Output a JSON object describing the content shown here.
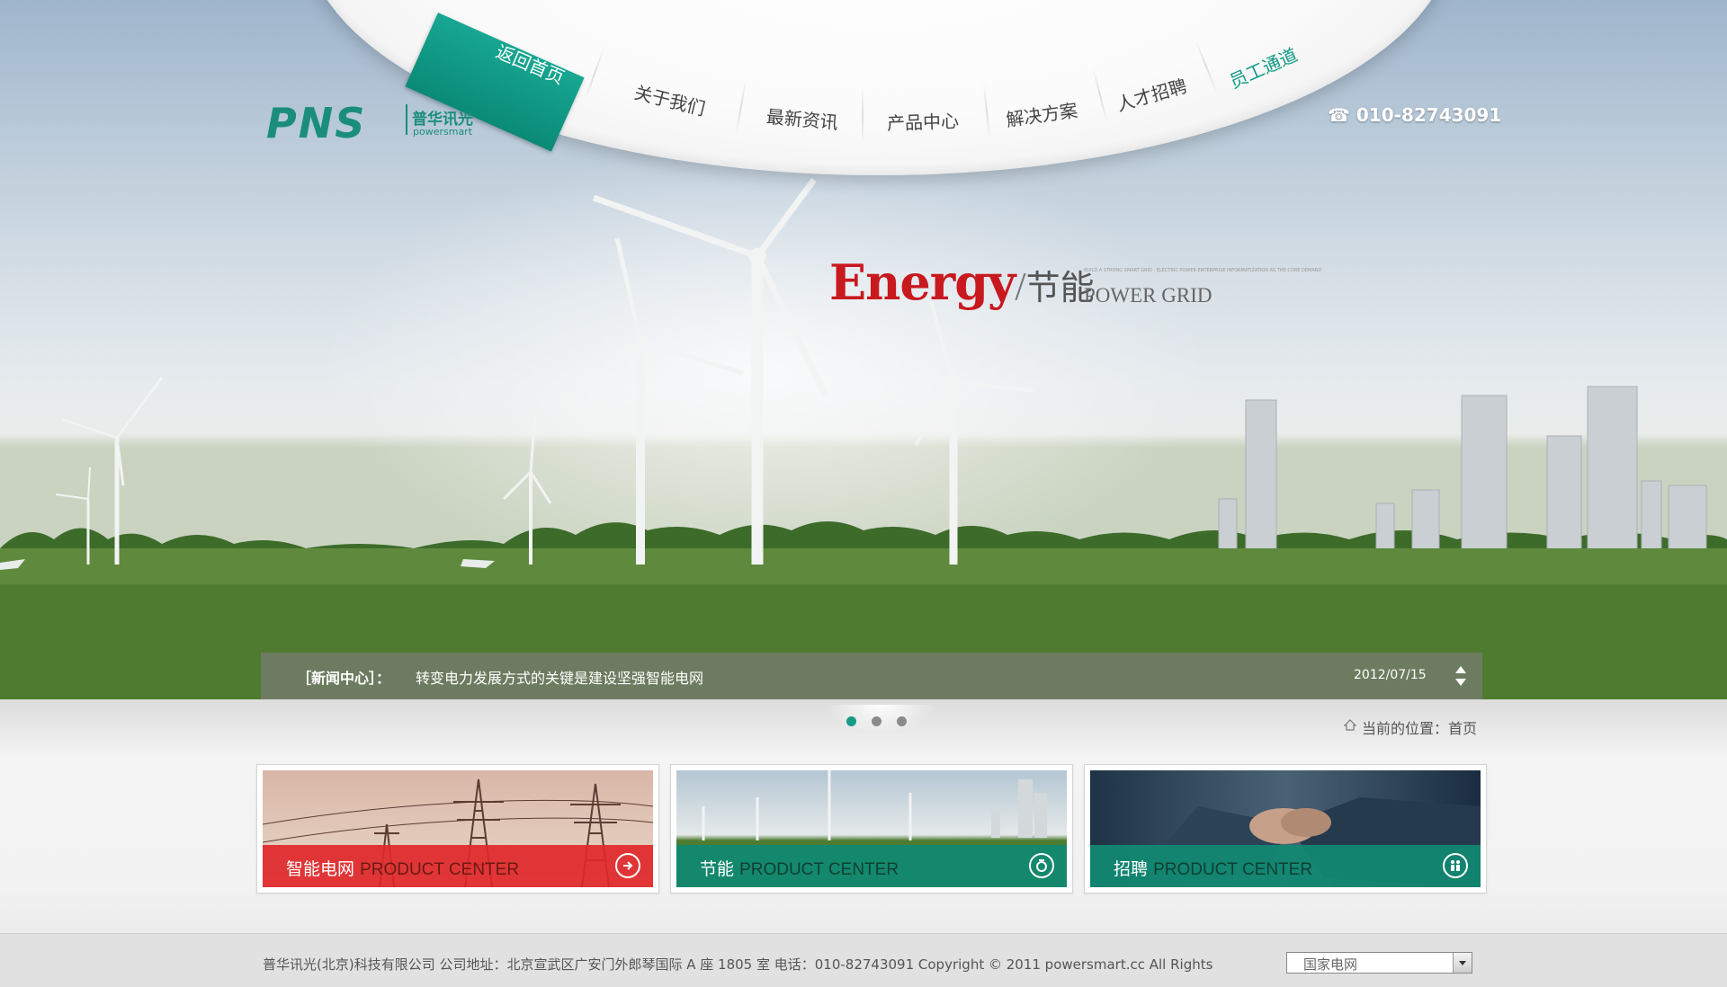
{
  "nav": {
    "items": [
      {
        "label": "返回首页"
      },
      {
        "label": "关于我们"
      },
      {
        "label": "最新资讯"
      },
      {
        "label": "产品中心"
      },
      {
        "label": "解决方案"
      },
      {
        "label": "人才招聘"
      },
      {
        "label": "员工通道"
      }
    ]
  },
  "logo": {
    "mark": "PNS",
    "cn": "普华讯光",
    "en": "powersmart"
  },
  "phone": "010-82743091",
  "slogan": {
    "en": "Energy",
    "cn": "节能",
    "sub": "POWER GRID",
    "tiny": "BUILD A STRONG SMART GRID · ELECTRIC POWER ENTERPRISE INFORMATIZATION AS THE CORE DEMAND"
  },
  "news": {
    "label": "［新闻中心］：",
    "text": "转变电力发展方式的关键是建设坚强智能电网",
    "date": "2012/07/15"
  },
  "breadcrumb": "当前的位置：首页",
  "cards": [
    {
      "cn": "智能电网",
      "en": "PRODUCT CENTER",
      "icon": "arrow-circle-icon",
      "color": "#e0272a"
    },
    {
      "cn": "节能",
      "en": "PRODUCT CENTER",
      "icon": "energy-circle-icon",
      "color": "#108a72"
    },
    {
      "cn": "招聘",
      "en": "PRODUCT CENTER",
      "icon": "people-circle-icon",
      "color": "#108a72"
    }
  ],
  "footer": {
    "text": "普华讯光(北京)科技有限公司 公司地址：北京宣武区广安门外郎琴国际 A 座 1805 室 电话：010-82743091 Copyright © 2011 powersmart.cc All Rights",
    "select_value": "国家电网"
  },
  "colors": {
    "brand": "#1a8e7a",
    "accent_red": "#c8191f",
    "active_dot": "#159a86"
  }
}
